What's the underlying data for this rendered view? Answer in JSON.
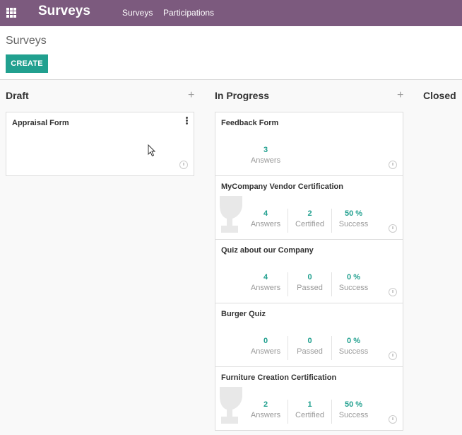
{
  "app": {
    "title": "Surveys",
    "nav": [
      "Surveys",
      "Participations"
    ]
  },
  "controlpanel": {
    "breadcrumb": "Surveys",
    "create_label": "CREATE"
  },
  "columns": [
    {
      "title": "Draft",
      "add_symbol": "+",
      "cards": [
        {
          "title": "Appraisal Form",
          "stats": []
        }
      ]
    },
    {
      "title": "In Progress",
      "add_symbol": "+",
      "cards": [
        {
          "title": "Feedback Form",
          "stats": [
            {
              "value": "3",
              "label": "Answers"
            }
          ]
        },
        {
          "title": "MyCompany Vendor Certification",
          "certification": true,
          "stats": [
            {
              "value": "4",
              "label": "Answers"
            },
            {
              "value": "2",
              "label": "Certified"
            },
            {
              "value": "50 %",
              "label": "Success"
            }
          ]
        },
        {
          "title": "Quiz about our Company",
          "stats": [
            {
              "value": "4",
              "label": "Answers"
            },
            {
              "value": "0",
              "label": "Passed"
            },
            {
              "value": "0 %",
              "label": "Success"
            }
          ]
        },
        {
          "title": "Burger Quiz",
          "stats": [
            {
              "value": "0",
              "label": "Answers"
            },
            {
              "value": "0",
              "label": "Passed"
            },
            {
              "value": "0 %",
              "label": "Success"
            }
          ]
        },
        {
          "title": "Furniture Creation Certification",
          "certification": true,
          "stats": [
            {
              "value": "2",
              "label": "Answers"
            },
            {
              "value": "1",
              "label": "Certified"
            },
            {
              "value": "50 %",
              "label": "Success"
            }
          ]
        }
      ]
    },
    {
      "title": "Closed",
      "cards": []
    }
  ],
  "colors": {
    "navbar": "#7c5a7e",
    "primary": "#21a08f",
    "stat_value": "#21a08f"
  },
  "icons": {
    "apps": "apps-grid-icon",
    "card_menu": "kebab-menu-icon",
    "activity": "clock-icon",
    "certification": "trophy-icon"
  }
}
